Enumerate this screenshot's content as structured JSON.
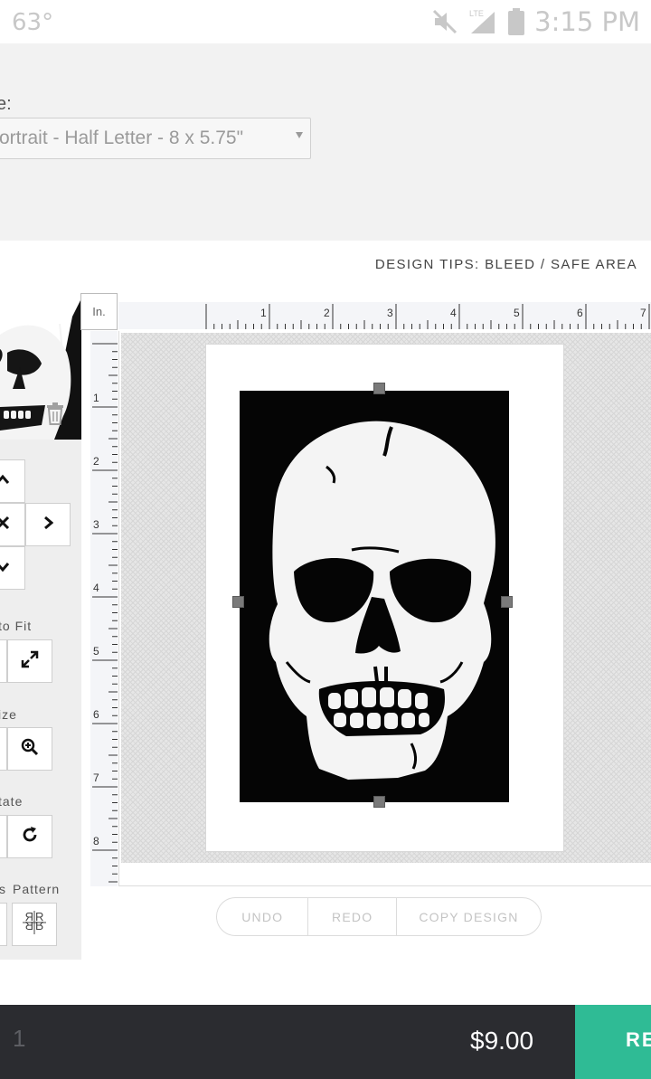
{
  "status_bar": {
    "temperature": "63°",
    "time": "3:15 PM",
    "icons": [
      "muted-speaker-icon",
      "lte-signal-icon",
      "battery-icon"
    ]
  },
  "options": {
    "size_label": "e:",
    "size_value": "ortrait - Half Letter - 8 x 5.75\""
  },
  "design_tips": "DESIGN TIPS: BLEED / SAFE AREA",
  "ruler": {
    "unit": "In.",
    "top_ticks": [
      "1",
      "2",
      "3",
      "4",
      "5",
      "6",
      "7"
    ],
    "left_ticks": [
      "1",
      "2",
      "3",
      "4",
      "5",
      "6",
      "7",
      "8"
    ]
  },
  "tools": {
    "fit_label": "to Fit",
    "size_label": "ize",
    "rotate_label": "tate",
    "pattern_label": "Pattern",
    "mirror_label_fragment": "s",
    "icons": [
      "chevron-up-icon",
      "center-icon",
      "chevron-right-icon",
      "chevron-down-icon",
      "expand-icon",
      "zoom-in-icon",
      "rotate-icon",
      "mirror-pattern-icon",
      "trash-icon"
    ]
  },
  "actions": {
    "undo": "UNDO",
    "redo": "REDO",
    "copy": "COPY DESIGN"
  },
  "bottom_bar": {
    "quantity": "1",
    "price": "$9.00",
    "review": "RE"
  },
  "colors": {
    "accent": "#2fbb95",
    "bottom_bar": "#2b2c30",
    "panel": "#f2f2f2"
  }
}
